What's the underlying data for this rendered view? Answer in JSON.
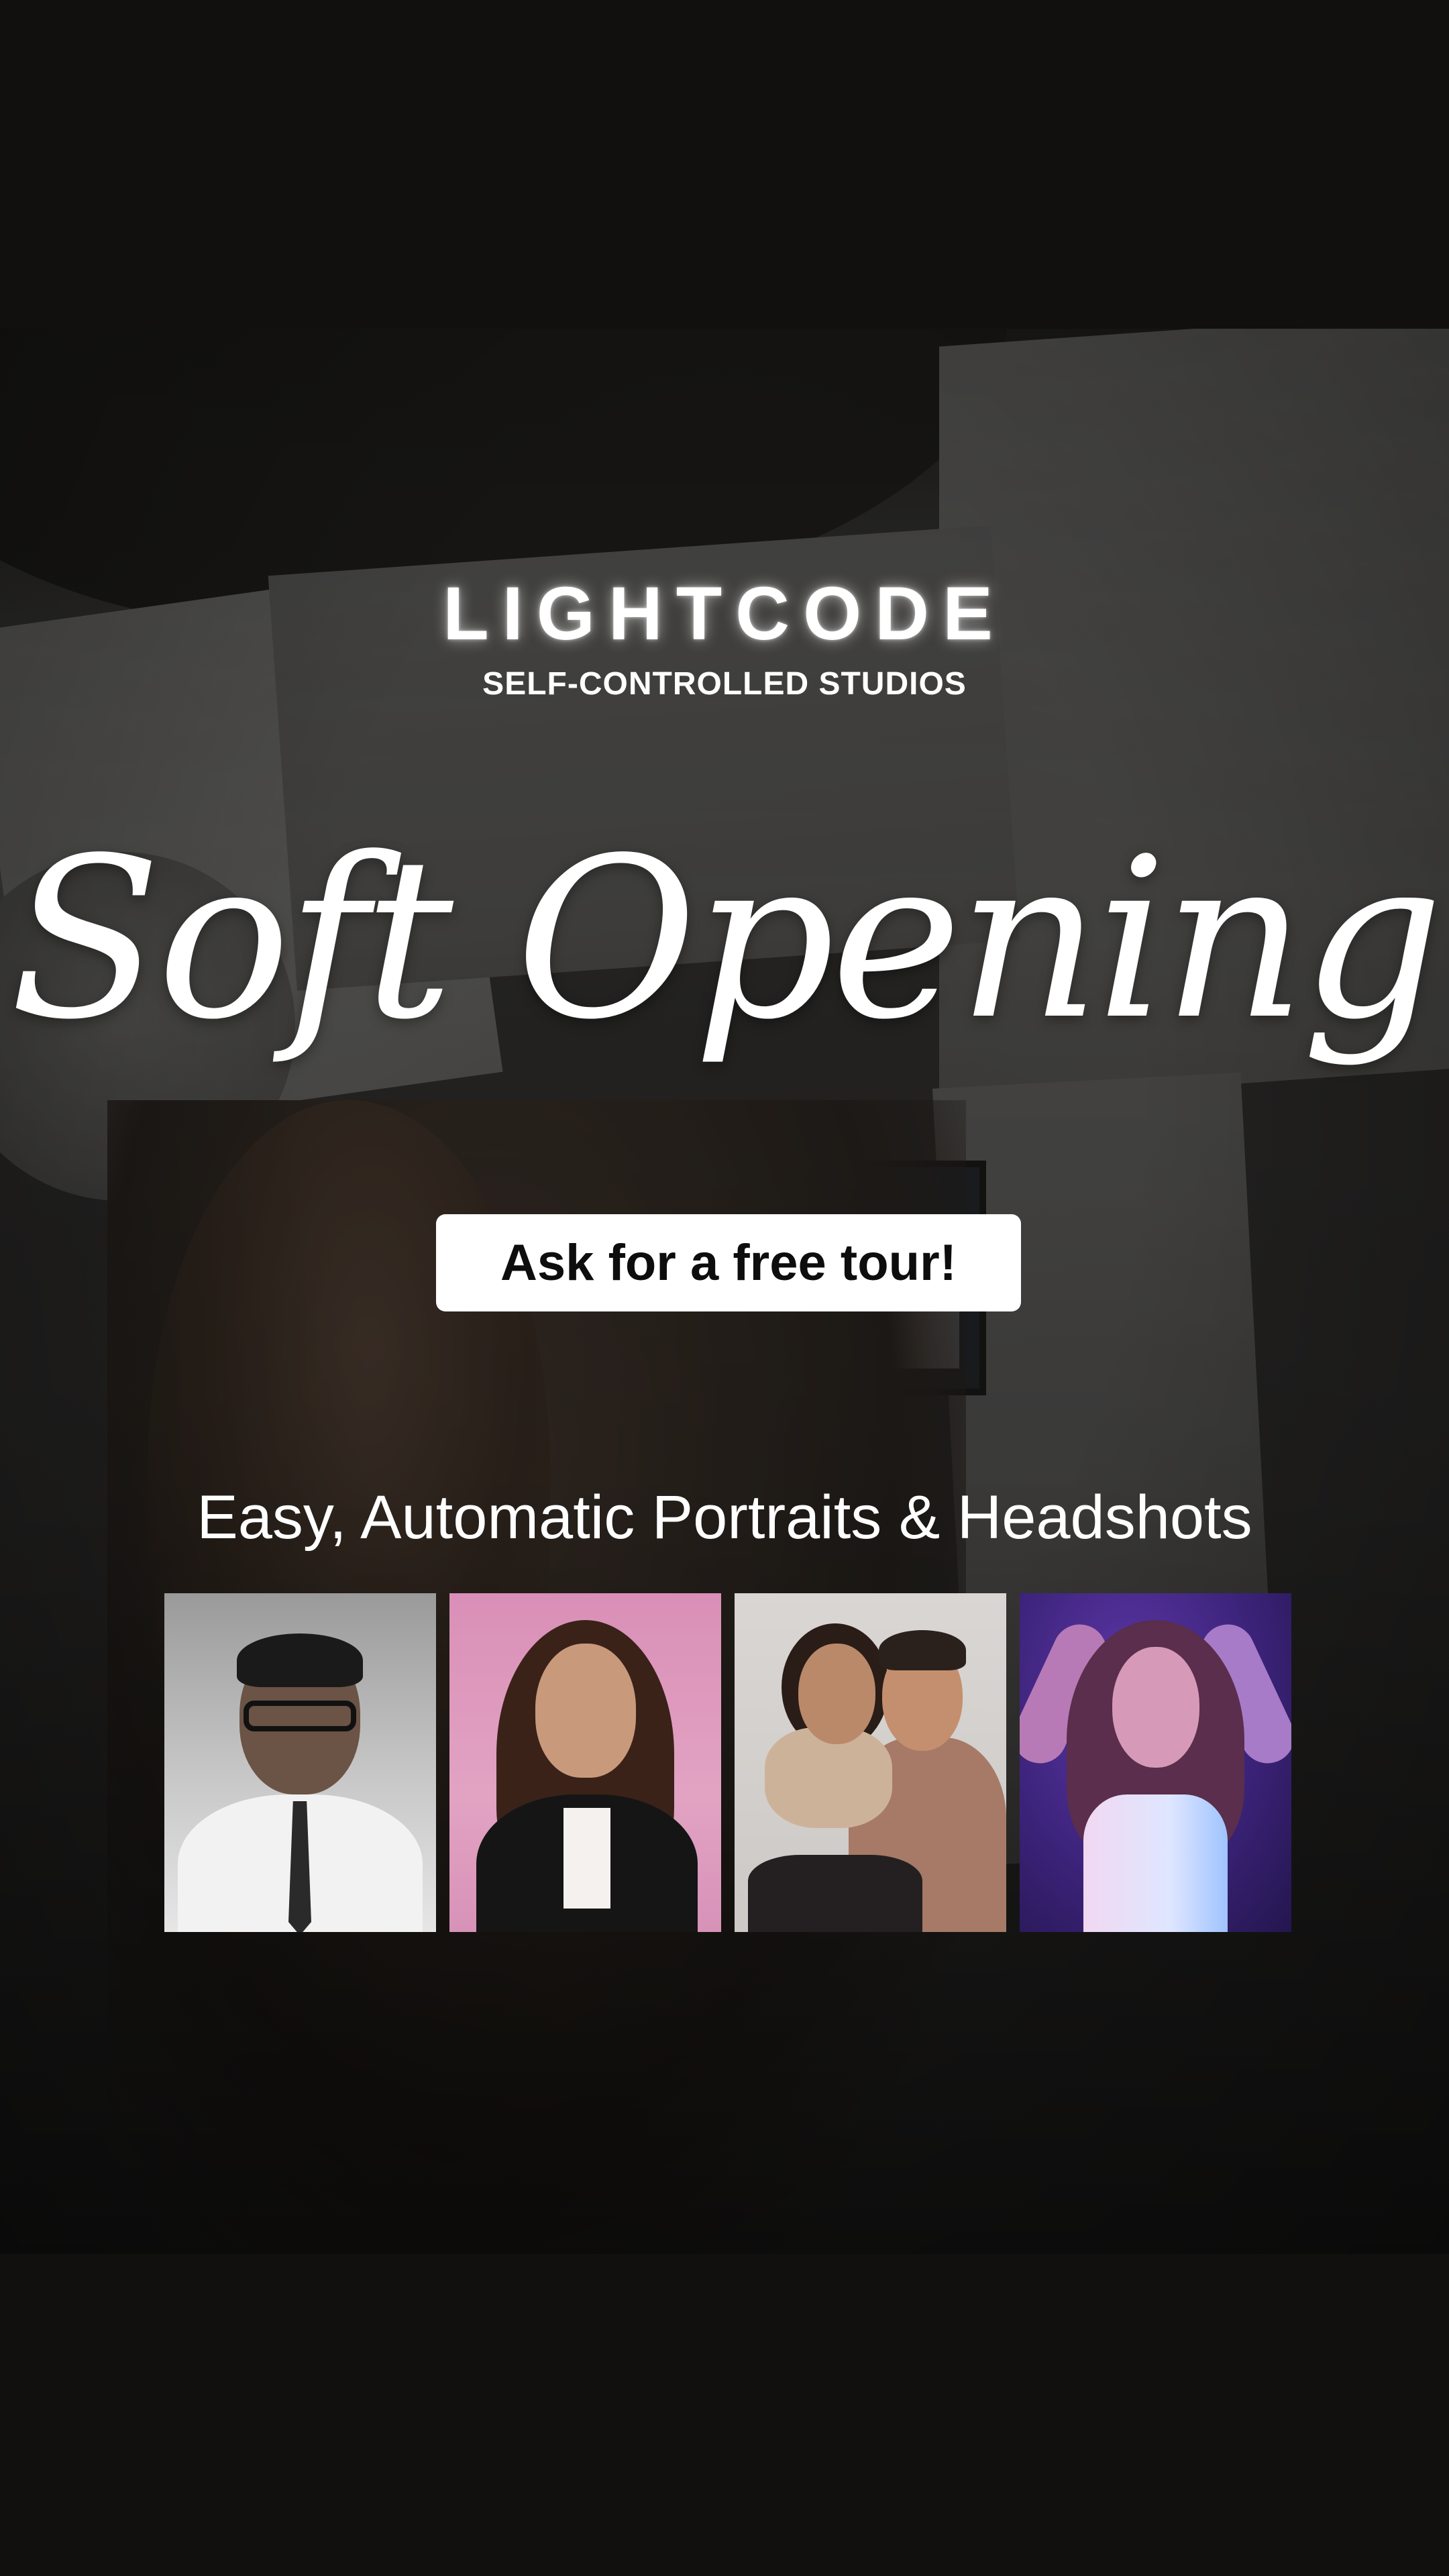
{
  "brand": {
    "name": "LIGHTCODE",
    "subtitle": "SELF-CONTROLLED STUDIOS"
  },
  "headline": "Soft Opening",
  "cta": {
    "label": "Ask for a free tour!"
  },
  "tagline": "Easy, Automatic Portraits & Headshots",
  "portraits": [
    {
      "name": "portrait-man-headshot",
      "color": "#c8c8c8"
    },
    {
      "name": "portrait-woman-blazer",
      "color": "#e2a3c3"
    },
    {
      "name": "portrait-couple",
      "color": "#d9d6d3"
    },
    {
      "name": "portrait-woman-neon",
      "color": "#3c237a"
    }
  ],
  "colors": {
    "background": "#11100e",
    "text": "#ffffff",
    "button_bg": "#ffffff",
    "button_text": "#0d0d0d"
  }
}
